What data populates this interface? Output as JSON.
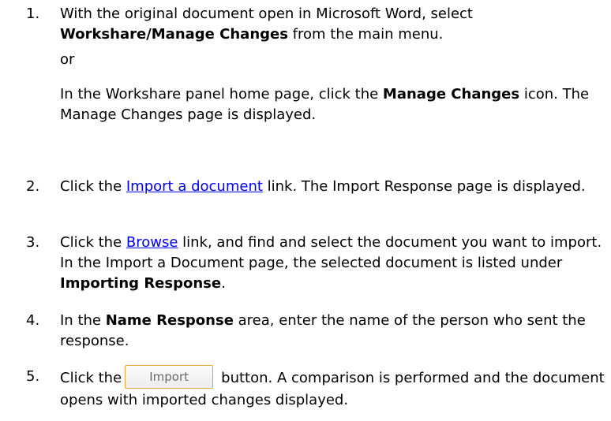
{
  "steps": [
    {
      "number": "1.",
      "line1": "With the original document open in Microsoft Word, select",
      "menu_a": "Workshare",
      "menu_sep": "/",
      "menu_b": "Manage Changes",
      "after_menu": " from the main menu.",
      "or": "or",
      "alt_text_a": "In the Workshare panel home page, click the ",
      "alt_bold": "Manage Changes",
      "alt_text_b": " icon. The Manage Changes page is displayed."
    },
    {
      "number": "2.",
      "text_a": "Click the ",
      "link": "Import a document",
      "text_b": " link. The Import Response page is displayed."
    },
    {
      "number": "3.",
      "text_a": "Click the ",
      "link": "Browse",
      "text_b": " link, and find and select the document you want to import. In the Import a Document page, the selected document is listed under ",
      "bold": "Importing Response",
      "text_c": "."
    },
    {
      "number": "4.",
      "text_a": "In the ",
      "bold": "Name Response",
      "text_b": " area, enter the name of the person who sent the response."
    },
    {
      "number": "5.",
      "text_a": "Click the",
      "button_label": "Import",
      "text_b": "button. A comparison is performed and the document opens with imported changes displayed."
    }
  ]
}
